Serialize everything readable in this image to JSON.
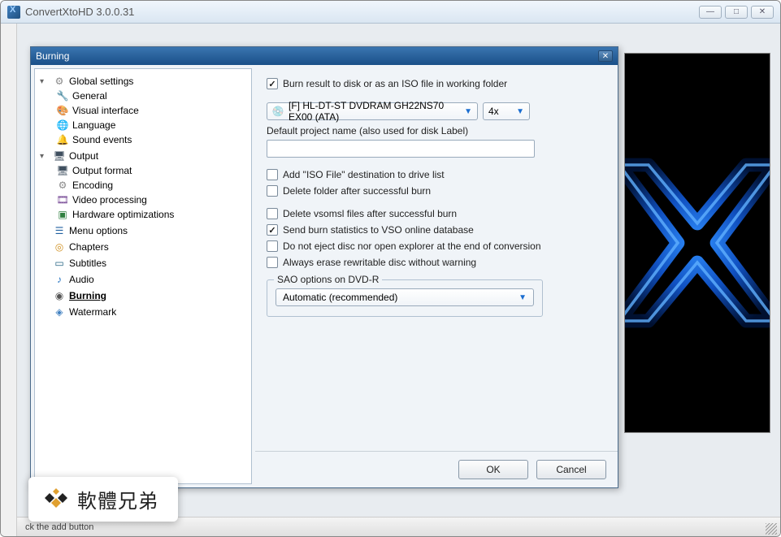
{
  "app": {
    "title": "ConvertXtoHD 3.0.0.31"
  },
  "statusbar": {
    "text": "ck the add button"
  },
  "dialog": {
    "title": "Burning",
    "ok_label": "OK",
    "cancel_label": "Cancel"
  },
  "tree": {
    "global_settings": "Global settings",
    "general": "General",
    "visual_interface": "Visual interface",
    "language": "Language",
    "sound_events": "Sound events",
    "output": "Output",
    "output_format": "Output format",
    "encoding": "Encoding",
    "video_processing": "Video processing",
    "hardware_opt": "Hardware optimizations",
    "menu_options": "Menu options",
    "chapters": "Chapters",
    "subtitles": "Subtitles",
    "audio": "Audio",
    "burning": "Burning",
    "watermark": "Watermark"
  },
  "settings": {
    "burn_result": "Burn result to disk or as an ISO file in working folder",
    "drive_label": "[F] HL-DT-ST DVDRAM GH22NS70 EX00 (ATA)",
    "speed": "4x",
    "default_project_label": "Default project name (also used for disk Label)",
    "default_project_value": "",
    "add_iso": "Add \"ISO File\" destination to drive list",
    "delete_folder": "Delete folder after successful burn",
    "delete_vsomsl": "Delete vsomsl files after successful burn",
    "send_stats": "Send burn statistics to VSO online database",
    "no_eject": "Do not eject disc nor open explorer at the end of conversion",
    "always_erase": "Always erase rewritable disc without warning",
    "sao_legend": "SAO options on DVD-R",
    "sao_value": "Automatic (recommended)"
  },
  "watermark_overlay": {
    "text": "軟體兄弟"
  }
}
